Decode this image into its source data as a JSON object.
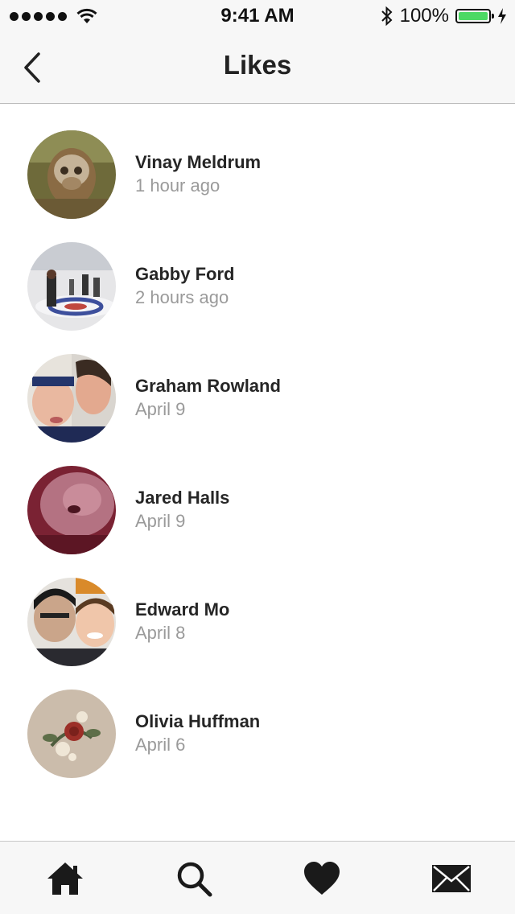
{
  "status_bar": {
    "time": "9:41 AM",
    "battery": "100%",
    "battery_level": 1.0,
    "signal_bars": 5
  },
  "nav": {
    "title": "Likes",
    "back_icon": "chevron-left-icon"
  },
  "likes": [
    {
      "name": "Vinay Meldrum",
      "time": "1 hour ago"
    },
    {
      "name": "Gabby Ford",
      "time": "2 hours ago"
    },
    {
      "name": "Graham Rowland",
      "time": "April 9"
    },
    {
      "name": "Jared Halls",
      "time": "April 9"
    },
    {
      "name": "Edward Mo",
      "time": "April 8"
    },
    {
      "name": "Olivia Huffman",
      "time": "April 6"
    }
  ],
  "tab_bar": {
    "tabs": [
      "home-icon",
      "search-icon",
      "heart-icon",
      "mail-icon"
    ]
  },
  "colors": {
    "battery_fill": "#4cd964",
    "secondary_text": "#9a9a9a",
    "bar_background": "#f7f7f7"
  }
}
